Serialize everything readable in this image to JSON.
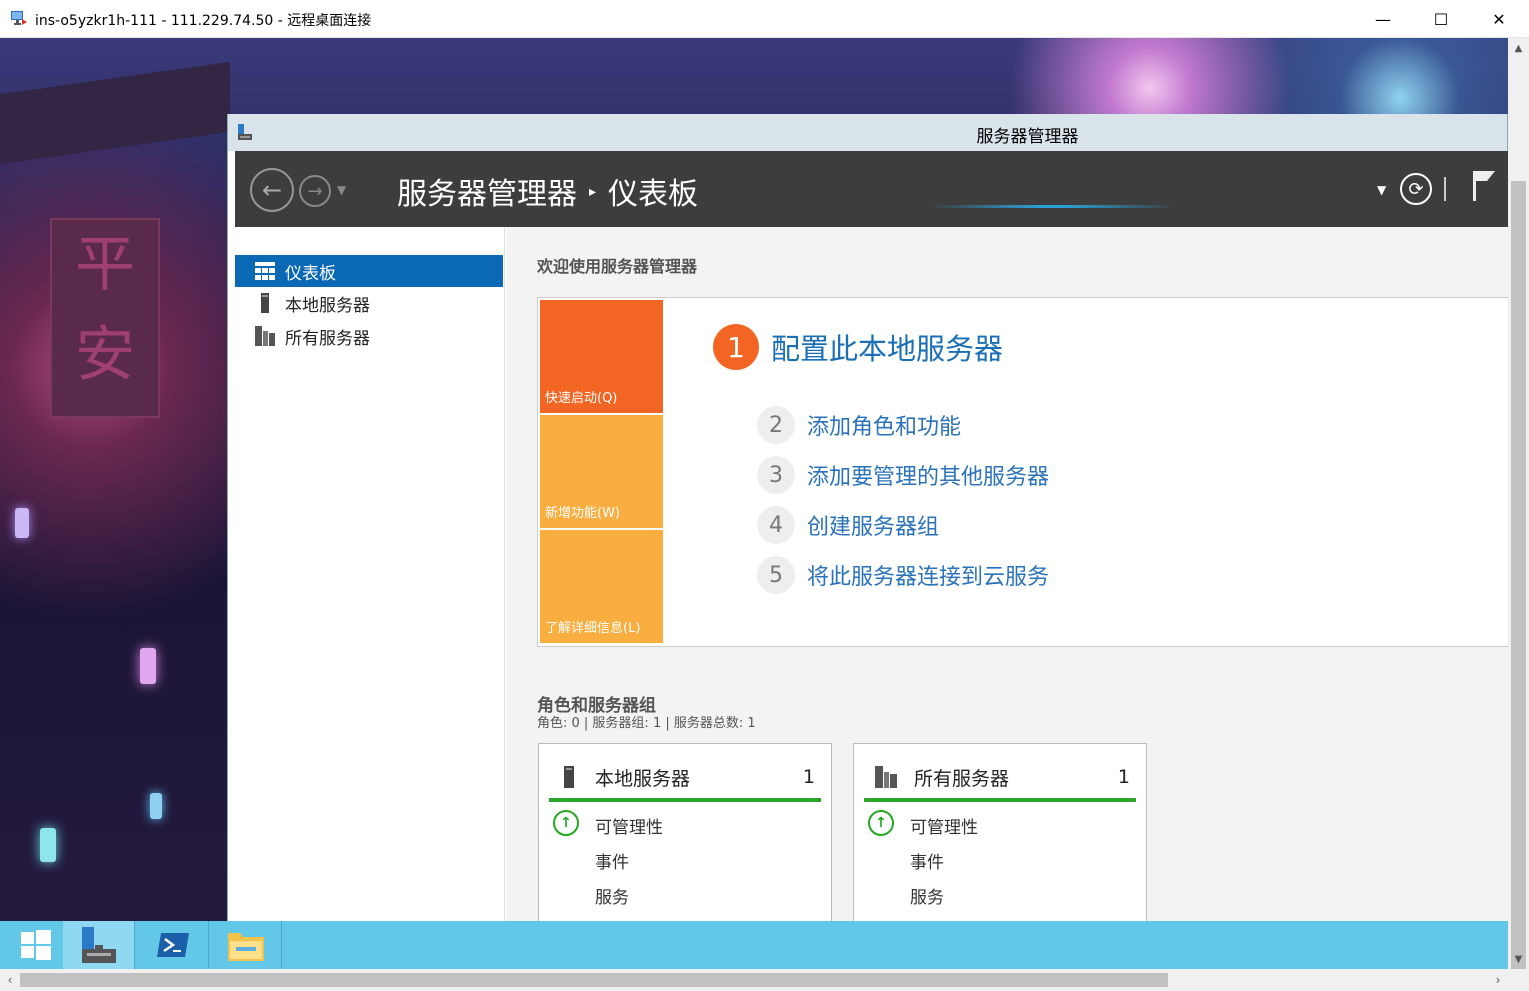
{
  "rdp": {
    "title": "ins-o5yzkr1h-111 - 111.229.74.50 - 远程桌面连接",
    "minimize": "—",
    "maximize": "☐",
    "close": "✕"
  },
  "wallpaper": {
    "pillar_text": "平安"
  },
  "server_manager": {
    "window_title": "服务器管理器",
    "breadcrumb": {
      "root": "服务器管理器",
      "separator": "▸",
      "current": "仪表板"
    }
  },
  "sidebar": {
    "items": [
      {
        "label": "仪表板",
        "icon": "dashboard-icon",
        "active": true
      },
      {
        "label": "本地服务器",
        "icon": "local-server-icon",
        "active": false
      },
      {
        "label": "所有服务器",
        "icon": "all-servers-icon",
        "active": false
      }
    ]
  },
  "welcome": {
    "title": "欢迎使用服务器管理器",
    "tiles": [
      "快速启动(Q)",
      "新增功能(W)",
      "了解详细信息(L)"
    ],
    "main_step": {
      "num": "1",
      "label": "配置此本地服务器"
    },
    "steps": [
      {
        "num": "2",
        "label": "添加角色和功能"
      },
      {
        "num": "3",
        "label": "添加要管理的其他服务器"
      },
      {
        "num": "4",
        "label": "创建服务器组"
      },
      {
        "num": "5",
        "label": "将此服务器连接到云服务"
      }
    ]
  },
  "roles": {
    "title": "角色和服务器组",
    "summary": "角色: 0 | 服务器组: 1 | 服务器总数: 1",
    "cards": [
      {
        "name": "本地服务器",
        "count": "1",
        "rows": [
          "可管理性",
          "事件",
          "服务"
        ]
      },
      {
        "name": "所有服务器",
        "count": "1",
        "rows": [
          "可管理性",
          "事件",
          "服务"
        ]
      }
    ]
  },
  "colors": {
    "accent_blue": "#0a68b4",
    "tile_orange": "#f26522",
    "tile_amber": "#f9ae3f",
    "status_green": "#2aa52a",
    "taskbar": "#63c7e8"
  }
}
